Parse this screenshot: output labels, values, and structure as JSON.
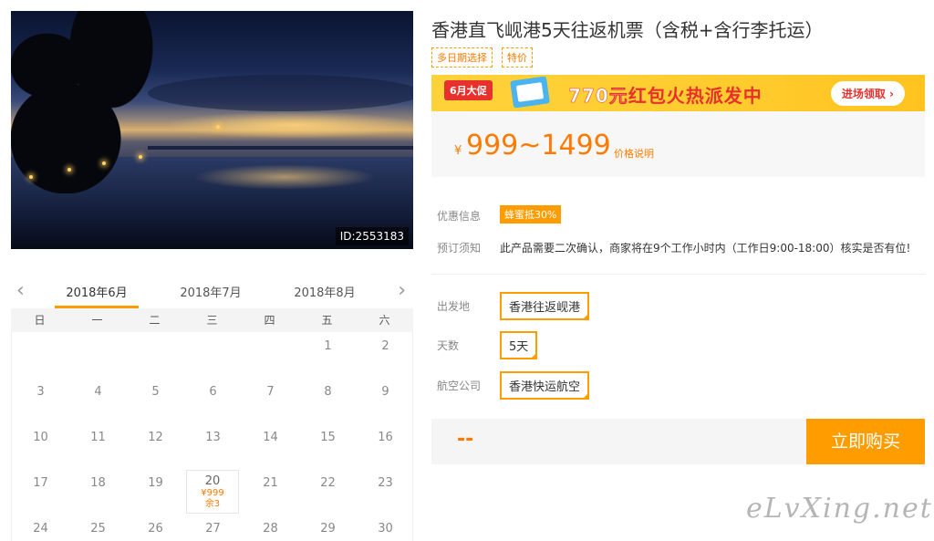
{
  "photo": {
    "id_label": "ID:2553183"
  },
  "calendar": {
    "prev_icon": "chevron-left-icon",
    "next_icon": "chevron-right-icon",
    "months": [
      "2018年6月",
      "2018年7月",
      "2018年8月"
    ],
    "weekdays": [
      "日",
      "一",
      "二",
      "三",
      "四",
      "五",
      "六"
    ],
    "days": [
      [
        "",
        "",
        "",
        "",
        "",
        "1",
        "2"
      ],
      [
        "3",
        "4",
        "5",
        "6",
        "7",
        "8",
        "9"
      ],
      [
        "10",
        "11",
        "12",
        "13",
        "14",
        "15",
        "16"
      ],
      [
        "17",
        "18",
        "19",
        "20",
        "21",
        "22",
        "23"
      ],
      [
        "24",
        "25",
        "26",
        "27",
        "28",
        "29",
        "30"
      ]
    ],
    "special_day": {
      "day": "20",
      "price": "¥999",
      "remain": "余3"
    }
  },
  "product": {
    "title": "香港直飞岘港5天往返机票（含税+含行李托运）",
    "tags": [
      "多日期选择",
      "特价"
    ]
  },
  "banner": {
    "badge": "6月大促",
    "amount": "770元",
    "text": "红包火热派发中",
    "enter": "进场领取 ›"
  },
  "price": {
    "currency": "¥",
    "range": "999~1499",
    "note": "价格说明"
  },
  "info": {
    "discount_label": "优惠信息",
    "discount_value": "蜂蜜抵30%",
    "notice_label": "预订须知",
    "notice_value": "此产品需要二次确认，商家将在9个工作小时内（工作日9:00-18:00）核实是否有位!"
  },
  "options": {
    "departure_label": "出发地",
    "departure_value": "香港往返岘港",
    "days_label": "天数",
    "days_value": "5天",
    "airline_label": "航空公司",
    "airline_value": "香港快运航空"
  },
  "purchase": {
    "total": "--",
    "buy_label": "立即购买"
  },
  "watermark": "eLvXing.net",
  "colors": {
    "accent": "#ff9d00",
    "price": "#ff7a00",
    "banner": "#ffcc2e",
    "banner_red": "#e8312d"
  }
}
